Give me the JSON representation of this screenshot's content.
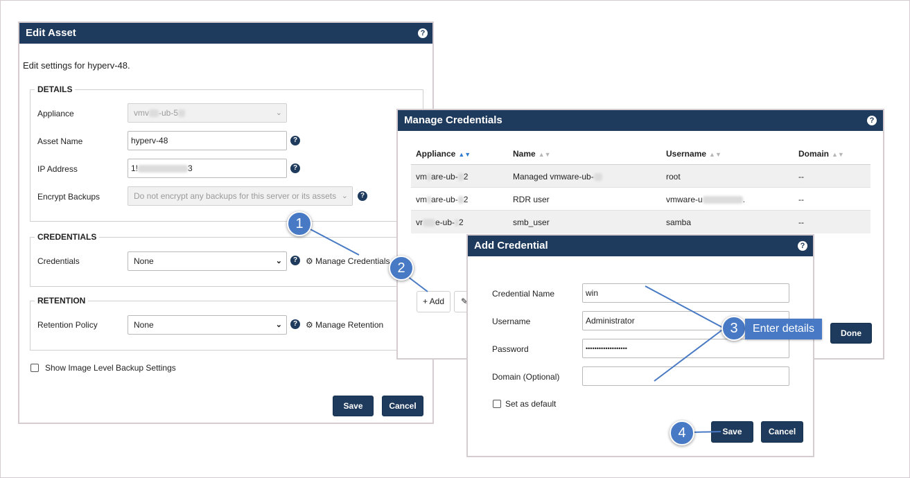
{
  "edit_asset": {
    "title": "Edit Asset",
    "help": "?",
    "description": "Edit settings for hyperv-48.",
    "details": {
      "legend": "DETAILS",
      "appliance_label": "Appliance",
      "appliance_value_a": "vmv",
      "appliance_value_b": "-ub-5",
      "asset_name_label": "Asset Name",
      "asset_name_value": "hyperv-48",
      "ip_label": "IP Address",
      "ip_value_a": "1!",
      "ip_value_b": "3",
      "encrypt_label": "Encrypt Backups",
      "encrypt_value": "Do not encrypt any backups for this server or its assets"
    },
    "credentials": {
      "legend": "CREDENTIALS",
      "label": "Credentials",
      "value": "None",
      "manage_link": "Manage Credentials"
    },
    "retention": {
      "legend": "RETENTION",
      "label": "Retention Policy",
      "value": "None",
      "manage_link": "Manage Retention"
    },
    "show_image_level": "Show Image Level Backup Settings",
    "save": "Save",
    "cancel": "Cancel"
  },
  "manage_credentials": {
    "title": "Manage Credentials",
    "help": "?",
    "columns": [
      "Appliance",
      "Name",
      "Username",
      "Domain"
    ],
    "rows": [
      {
        "appliance_a": "vm",
        "appliance_b": "are-ub-",
        "appliance_c": "2",
        "name_a": "Managed vmware-ub-",
        "username": "root",
        "domain": "--"
      },
      {
        "appliance_a": "vm",
        "appliance_b": "are-ub-",
        "appliance_c": "2",
        "name_a": "RDR user",
        "username": "vmware-u",
        "domain": "--"
      },
      {
        "appliance_a": "vr",
        "appliance_b": "e-ub-",
        "appliance_c": "2",
        "name_a": "smb_user",
        "username": "samba",
        "domain": "--"
      }
    ],
    "add": "Add",
    "done": "Done"
  },
  "add_credential": {
    "title": "Add Credential",
    "help": "?",
    "credential_name_label": "Credential Name",
    "credential_name_value": "win",
    "username_label": "Username",
    "username_value": "Administrator",
    "password_label": "Password",
    "password_value": "•••••••••••••••••••",
    "domain_label": "Domain (Optional)",
    "domain_value": "",
    "set_default": "Set as default",
    "save": "Save",
    "cancel": "Cancel"
  },
  "callouts": {
    "one": "1",
    "two": "2",
    "three": "3",
    "three_text": "Enter details",
    "four": "4"
  },
  "colors": {
    "titlebar": "#1e3a5c",
    "callout": "#4779c4",
    "sort_active": "#2e7bd1"
  }
}
